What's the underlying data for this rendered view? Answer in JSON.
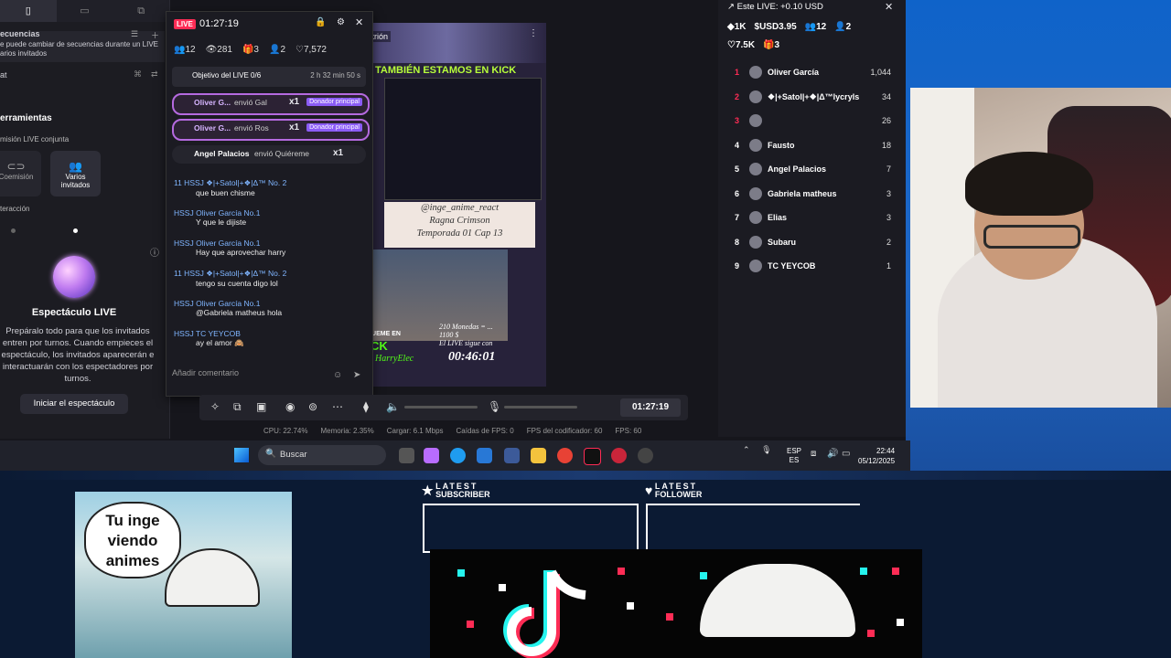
{
  "studio": {
    "tabs": [
      "▯",
      "▭",
      "⧉"
    ],
    "tip_title": "ecuencias",
    "tip_text": "e puede cambiar de secuencias durante un LIVE",
    "tip_text2": "arios invitados",
    "chat_label": "at",
    "tools_heading": "erramientas",
    "joint_live": "misión LIVE conjunta",
    "option_cohost": "Coemisión",
    "option_guests": "Varios invitados",
    "interaction": "teracción",
    "show_title": "Espectáculo LIVE",
    "show_desc": "Prepáralo todo para que los invitados entren por turnos. Cuando empieces el espectáculo, los invitados aparecerán e interactuarán con los espectadores por turnos.",
    "start_button": "Iniciar el espectáculo"
  },
  "chat_window": {
    "live_badge": "LIVE",
    "elapsed": "01:27:19",
    "stats": [
      "12",
      "281",
      "3",
      "2",
      "7,572"
    ],
    "goal_label": "Objetivo del LIVE 0/6",
    "goal_time": "2 h 32 min 50 s",
    "gifts": [
      {
        "user": "Oliver G...",
        "text": "envió Gal",
        "count": "x1",
        "tag": "Donador principal"
      },
      {
        "user": "Oliver G...",
        "text": "envió Ros",
        "count": "x1",
        "tag": "Donador principal"
      },
      {
        "user": "Angel Palacios",
        "text": "envió Quiéreme",
        "count": "x1",
        "tag": ""
      }
    ],
    "messages": [
      {
        "user": "11 HSSJ ❖|+Satol|+❖|Δ™ No. 2",
        "text": "que buen chisme"
      },
      {
        "user": "HSSJ Oliver García No.1",
        "text": "Y que le dijiste"
      },
      {
        "user": "HSSJ Oliver García No.1",
        "text": "Hay que aprovechar harry"
      },
      {
        "user": "11 HSSJ ❖|+Satol|+❖|Δ™ No. 2",
        "text": "tengo su cuenta digo lol"
      },
      {
        "user": "HSSJ Oliver García No.1",
        "text": "@Gabriela matheus hola"
      },
      {
        "user": "HSSJ TC YEYCOB",
        "text": "ay el amor 🙈"
      }
    ],
    "comment_placeholder": "Añadir comentario"
  },
  "preview": {
    "host_label": "Anfitrión",
    "kick_banner": "TAMBIÉN ESTAMOS EN KICK",
    "band_line1": "@inge_anime_react",
    "band_line2": "Ragna Crimson",
    "band_line3": "Temporada 01 Cap 13",
    "kick_follow": "SIGUEME EN",
    "kick_word": "KICK",
    "kick_handle": "HarryElec",
    "coins_line1": "210 Monedas = ...",
    "coins_line2": "1100 $",
    "coins_line3": "El LIVE sigue con",
    "timer": "00:46:01"
  },
  "controls": {
    "clock": "01:27:19",
    "sysinfo": [
      "CPU: 22.74%",
      "Memoria: 2.35%",
      "Cargar: 6.1 Mbps",
      "Caídas de FPS: 0",
      "FPS del codificador: 60",
      "FPS: 60"
    ]
  },
  "leaderboard": {
    "title": "Este LIVE: +0.10 USD",
    "stats1": [
      "1K",
      "USD3.95",
      "12",
      "2"
    ],
    "stats2": [
      "7.5K",
      "3"
    ],
    "rows": [
      {
        "rank": "1",
        "name": "Oliver García",
        "score": "1,044",
        "color": "#fe2c55"
      },
      {
        "rank": "2",
        "name": "❖|+Satol|+❖|Δ™lycryls",
        "score": "34",
        "color": "#fe2c55"
      },
      {
        "rank": "3",
        "name": "",
        "score": "26",
        "color": "#fe2c55"
      },
      {
        "rank": "4",
        "name": "Fausto",
        "score": "18",
        "color": "#ffffff"
      },
      {
        "rank": "5",
        "name": "Angel Palacios",
        "score": "7",
        "color": "#ffffff"
      },
      {
        "rank": "6",
        "name": "Gabriela matheus",
        "score": "3",
        "color": "#ffffff"
      },
      {
        "rank": "7",
        "name": "Elias",
        "score": "3",
        "color": "#ffffff"
      },
      {
        "rank": "8",
        "name": "Subaru",
        "score": "2",
        "color": "#ffffff"
      },
      {
        "rank": "9",
        "name": "TC YEYCOB",
        "score": "1",
        "color": "#ffffff"
      }
    ]
  },
  "taskbar": {
    "search_placeholder": "Buscar",
    "lang1": "ESP",
    "lang2": "ES",
    "time": "22:44",
    "date": "05/12/2025"
  },
  "overlay": {
    "bubble": "Tu inge viendo animes",
    "latest1_a": "LATEST",
    "latest1_b": "SUBSCRIBER",
    "latest2_a": "LATEST",
    "latest2_b": "FOLLOWER"
  },
  "colors": {
    "accent_live": "#fe2c55",
    "gift_border": "#b56ae0",
    "kick_green": "#53fc18",
    "desktop_blue": "#0f63c9"
  }
}
